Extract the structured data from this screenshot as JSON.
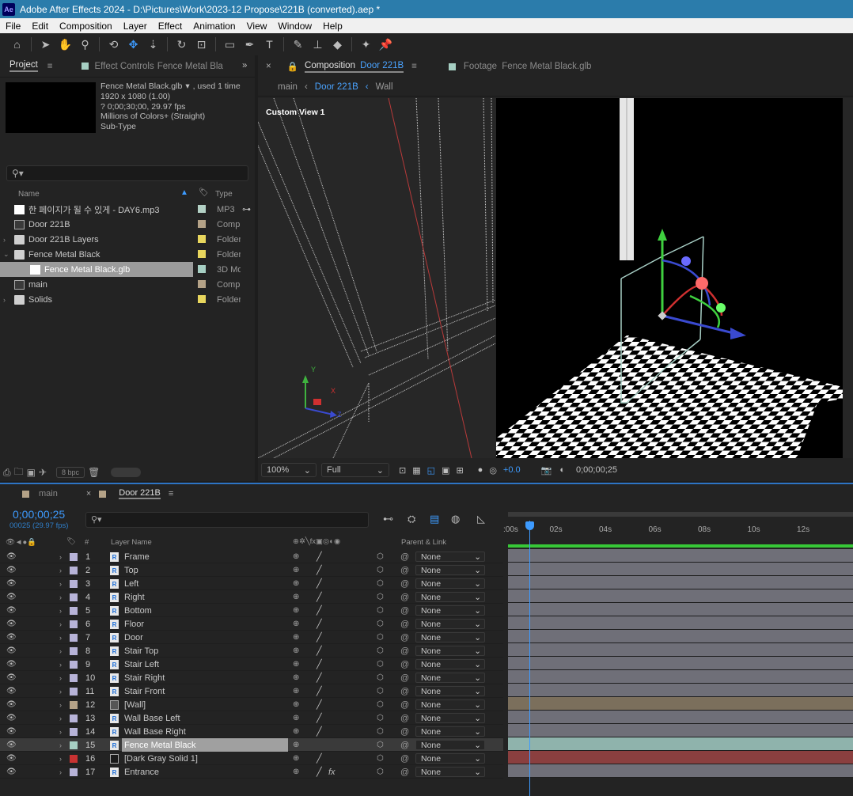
{
  "window": {
    "title": "Adobe After Effects 2024 - D:\\Pictures\\Work\\2023-12 Propose\\221B (converted).aep *",
    "logo": "Ae"
  },
  "menu": [
    "File",
    "Edit",
    "Composition",
    "Layer",
    "Effect",
    "Animation",
    "View",
    "Window",
    "Help"
  ],
  "toolbar_icons": [
    "home-icon",
    "selection-tool-icon",
    "hand-tool-icon",
    "zoom-tool-icon",
    "orbit-tool-icon",
    "pan-tool-icon",
    "dolly-tool-icon",
    "rotate-tool-icon",
    "pan-behind-tool-icon",
    "rectangle-tool-icon",
    "pen-tool-icon",
    "type-tool-icon",
    "brush-tool-icon",
    "clone-stamp-icon",
    "eraser-tool-icon",
    "roto-brush-icon",
    "puppet-pin-icon"
  ],
  "project": {
    "tab_project": "Project",
    "tab_effects": "Effect Controls",
    "tab_effects_target": "Fence Metal Bla",
    "info_name": "Fence Metal Black.glb",
    "info_used": ", used 1 time",
    "info_size": "1920 x 1080 (1.00)",
    "info_duration": "? 0;00;30;00, 29.97 fps",
    "info_colors": "Millions of Colors+ (Straight)",
    "info_subtype": "Sub-Type",
    "col_name": "Name",
    "col_type": "Type",
    "items": [
      {
        "name": "한 페이지가 될 수 있게 - DAY6.mp3",
        "type": "MP3",
        "color": "#b3d1c5",
        "kind": "audio"
      },
      {
        "name": "Door 221B",
        "type": "Comp",
        "color": "#b4a287",
        "kind": "comp"
      },
      {
        "name": "Door 221B Layers",
        "type": "Folder",
        "color": "#e8d65d",
        "kind": "folder"
      },
      {
        "name": "Fence Metal Black",
        "type": "Folder",
        "color": "#e8d65d",
        "kind": "folder-open"
      },
      {
        "name": "Fence Metal Black.glb",
        "type": "3D Mo",
        "color": "#a6cfc3",
        "kind": "file",
        "selected": true
      },
      {
        "name": "main",
        "type": "Comp",
        "color": "#b4a287",
        "kind": "comp"
      },
      {
        "name": "Solids",
        "type": "Folder",
        "color": "#e8d65d",
        "kind": "folder"
      }
    ],
    "bpc": "8 bpc"
  },
  "composition": {
    "tab_label": "Composition",
    "tab_name": "Door 221B",
    "footage_label": "Footage",
    "footage_name": "Fence Metal Black.glb",
    "breadcrumb": [
      "main",
      "Door 221B",
      "Wall"
    ],
    "view_label": "Custom View 1",
    "zoom": "100%",
    "resolution": "Full",
    "exposure": "+0.0",
    "timecode": "0;00;00;25"
  },
  "timeline": {
    "tab_main": "main",
    "tab_comp": "Door 221B",
    "timecode": "0;00;00;25",
    "frames": "00025 (29.97 fps)",
    "col_layer_name": "Layer Name",
    "col_parent": "Parent & Link",
    "col_hash": "#",
    "ruler": [
      ":00s",
      "02s",
      "04s",
      "06s",
      "08s",
      "10s",
      "12s"
    ],
    "layers": [
      {
        "num": "1",
        "name": "Frame",
        "label": "#b7b3d8",
        "parent": "None"
      },
      {
        "num": "2",
        "name": "Top",
        "label": "#b7b3d8",
        "parent": "None"
      },
      {
        "num": "3",
        "name": "Left",
        "label": "#b7b3d8",
        "parent": "None"
      },
      {
        "num": "4",
        "name": "Right",
        "label": "#b7b3d8",
        "parent": "None"
      },
      {
        "num": "5",
        "name": "Bottom",
        "label": "#b7b3d8",
        "parent": "None"
      },
      {
        "num": "6",
        "name": "Floor",
        "label": "#b7b3d8",
        "parent": "None"
      },
      {
        "num": "7",
        "name": "Door",
        "label": "#b7b3d8",
        "parent": "None"
      },
      {
        "num": "8",
        "name": "Stair Top",
        "label": "#b7b3d8",
        "parent": "None"
      },
      {
        "num": "9",
        "name": "Stair Left",
        "label": "#b7b3d8",
        "parent": "None"
      },
      {
        "num": "10",
        "name": "Stair Right",
        "label": "#b7b3d8",
        "parent": "None"
      },
      {
        "num": "11",
        "name": "Stair Front",
        "label": "#b7b3d8",
        "parent": "None"
      },
      {
        "num": "12",
        "name": "[Wall]",
        "label": "#b4a287",
        "parent": "None"
      },
      {
        "num": "13",
        "name": "Wall Base Left",
        "label": "#b7b3d8",
        "parent": "None"
      },
      {
        "num": "14",
        "name": "Wall Base Right",
        "label": "#b7b3d8",
        "parent": "None"
      },
      {
        "num": "15",
        "name": "Fence Metal Black",
        "label": "#a6cfc3",
        "parent": "None",
        "selected": true
      },
      {
        "num": "16",
        "name": "[Dark Gray Solid 1]",
        "label": "#c83232",
        "parent": "None"
      },
      {
        "num": "17",
        "name": "Entrance",
        "label": "#b7b3d8",
        "parent": "None",
        "fx": "fx"
      }
    ]
  },
  "colors": {
    "accent": "#3d9bff",
    "titlebar": "#2b7cab",
    "layer_bar": "#6f6f78",
    "wall_bar": "#7b6f5c",
    "fence_bar": "#8fb3ac",
    "solid_bar": "#8a3f3f"
  }
}
